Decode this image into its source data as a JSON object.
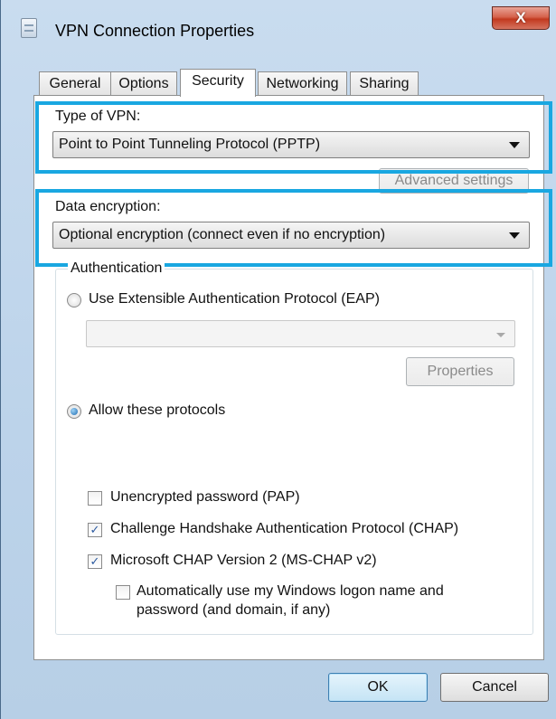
{
  "window": {
    "title": "VPN Connection Properties",
    "close_glyph": "X",
    "icon": "document-icon"
  },
  "tabs": [
    {
      "label": "General"
    },
    {
      "label": "Options"
    },
    {
      "label": "Security",
      "active": true
    },
    {
      "label": "Networking"
    },
    {
      "label": "Sharing"
    }
  ],
  "security": {
    "type_of_vpn_label": "Type of VPN:",
    "type_of_vpn_value": "Point to Point Tunneling Protocol (PPTP)",
    "advanced_settings_label": "Advanced settings",
    "data_encryption_label": "Data encryption:",
    "data_encryption_value": "Optional encryption (connect even if no encryption)",
    "highlight_color": "#19a7e1"
  },
  "authentication": {
    "title": "Authentication",
    "eap_label": "Use Extensible Authentication Protocol (EAP)",
    "eap_selected": false,
    "eap_dropdown_value": "",
    "properties_label": "Properties",
    "allow_label": "Allow these protocols",
    "allow_selected": true,
    "protocols": [
      {
        "label": "Unencrypted password (PAP)",
        "checked": false
      },
      {
        "label": "Challenge Handshake Authentication Protocol (CHAP)",
        "checked": true
      },
      {
        "label": "Microsoft CHAP Version 2 (MS-CHAP v2)",
        "checked": true
      }
    ],
    "auto_logon_line1": "Automatically use my Windows logon name and",
    "auto_logon_line2": "password (and domain, if any)",
    "auto_logon_checked": false
  },
  "footer": {
    "ok_label": "OK",
    "cancel_label": "Cancel"
  }
}
